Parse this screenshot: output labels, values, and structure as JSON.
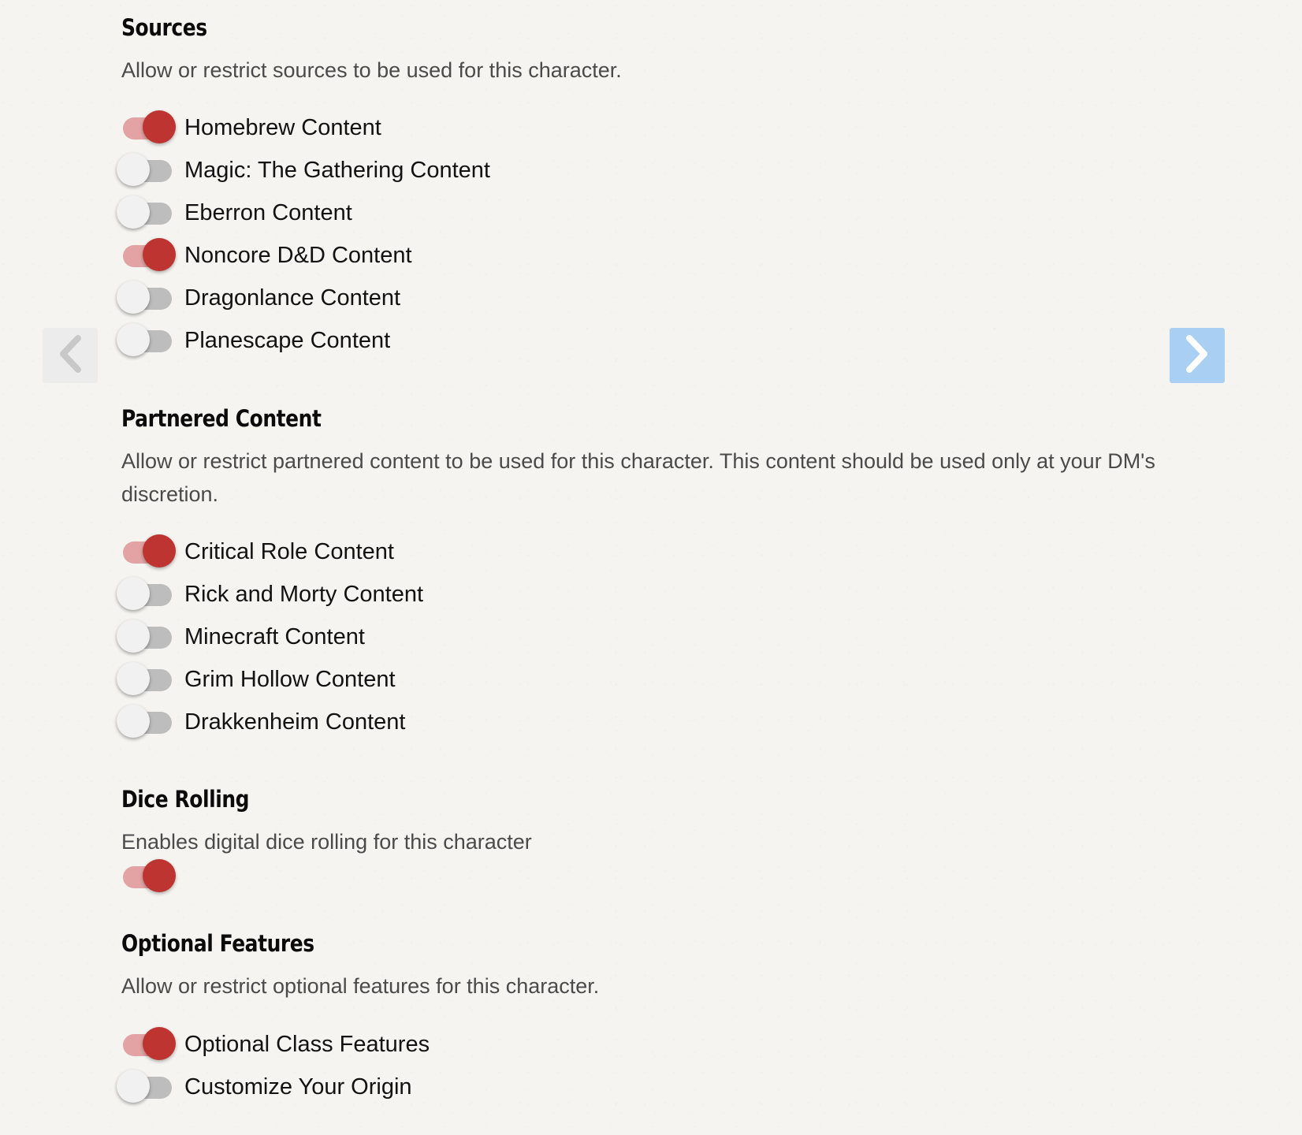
{
  "navigation": {
    "prev_icon": "chevron-left-icon",
    "next_icon": "chevron-right-icon",
    "prev_color": "#c8c8c8",
    "next_color": "#ffffff",
    "next_bg": "#a9cff2"
  },
  "colors": {
    "toggle_on_knob": "#bd3431",
    "toggle_on_track": "#e3a2a4",
    "toggle_off_knob": "#f1f1f1",
    "toggle_off_track": "#bdbdbd"
  },
  "sections": {
    "sources": {
      "title": "Sources",
      "description": "Allow or restrict sources to be used for this character.",
      "items": [
        {
          "label": "Homebrew Content",
          "on": true
        },
        {
          "label": "Magic: The Gathering Content",
          "on": false
        },
        {
          "label": "Eberron Content",
          "on": false
        },
        {
          "label": "Noncore D&D Content",
          "on": true
        },
        {
          "label": "Dragonlance Content",
          "on": false
        },
        {
          "label": "Planescape Content",
          "on": false
        }
      ]
    },
    "partnered": {
      "title": "Partnered Content",
      "description": "Allow or restrict partnered content to be used for this character. This content should be used only at your DM's discretion.",
      "items": [
        {
          "label": "Critical Role Content",
          "on": true
        },
        {
          "label": "Rick and Morty Content",
          "on": false
        },
        {
          "label": "Minecraft Content",
          "on": false
        },
        {
          "label": "Grim Hollow Content",
          "on": false
        },
        {
          "label": "Drakkenheim Content",
          "on": false
        }
      ]
    },
    "dice": {
      "title": "Dice Rolling",
      "description": "Enables digital dice rolling for this character",
      "enabled": true
    },
    "optional": {
      "title": "Optional Features",
      "description": "Allow or restrict optional features for this character.",
      "items": [
        {
          "label": "Optional Class Features",
          "on": true
        },
        {
          "label": "Customize Your Origin",
          "on": false
        }
      ]
    }
  }
}
